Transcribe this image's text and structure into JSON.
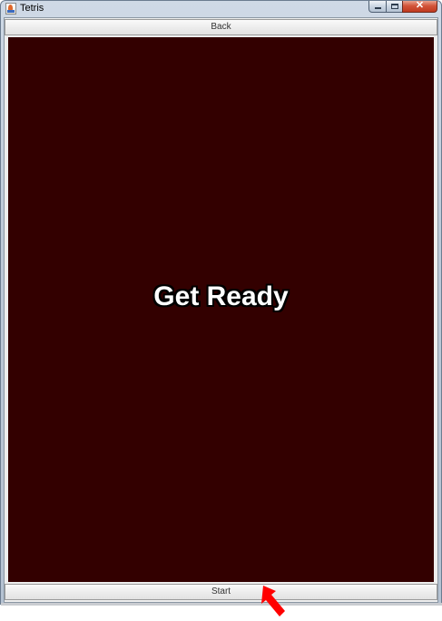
{
  "window": {
    "title": "Tetris",
    "controls": {
      "minimize_icon": "minimize-icon",
      "maximize_icon": "maximize-icon",
      "close_icon": "close-icon",
      "close_glyph": "✕"
    }
  },
  "toolbar": {
    "back_label": "Back"
  },
  "game": {
    "message": "Get Ready",
    "background_color": "#330000"
  },
  "footer": {
    "start_label": "Start"
  },
  "annotation": {
    "arrow_icon": "red-pointer-arrow-icon",
    "arrow_color": "#ff0000"
  }
}
